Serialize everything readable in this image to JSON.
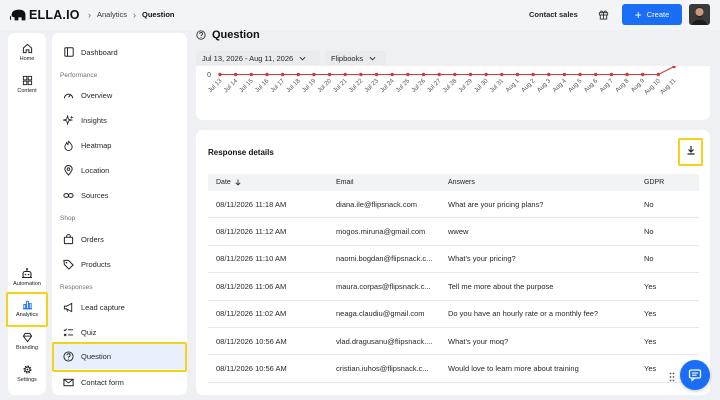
{
  "brand": {
    "name": "ELLA.IO",
    "accent": "#1a6ef5",
    "highlight": "#f5d21a"
  },
  "breadcrumb": {
    "items": [
      "Analytics",
      "Question"
    ]
  },
  "header": {
    "contact_sales": "Contact sales",
    "create_label": "Create"
  },
  "rail": {
    "items": [
      {
        "label": "Home",
        "icon": "home-icon"
      },
      {
        "label": "Content",
        "icon": "grid-icon"
      },
      {
        "label": "Automation",
        "icon": "robot-icon"
      },
      {
        "label": "Analytics",
        "icon": "bar-chart-icon",
        "active": true
      },
      {
        "label": "Branding",
        "icon": "diamond-icon"
      },
      {
        "label": "Settings",
        "icon": "gear-icon"
      }
    ]
  },
  "subnav": {
    "dashboard": "Dashboard",
    "section_performance": "Performance",
    "overview": "Overview",
    "insights": "Insights",
    "heatmap": "Heatmap",
    "location": "Location",
    "sources": "Sources",
    "section_shop": "Shop",
    "orders": "Orders",
    "products": "Products",
    "section_responses": "Responses",
    "lead_capture": "Lead capture",
    "quiz": "Quiz",
    "question": "Question",
    "contact_form": "Contact form"
  },
  "page": {
    "title": "Question",
    "date_range": "Jul 13, 2026 - Aug 11, 2026",
    "content_filter": "Flipbooks"
  },
  "chart_data": {
    "type": "line",
    "x": [
      "Jul 13",
      "Jul 14",
      "Jul 15",
      "Jul 16",
      "Jul 17",
      "Jul 18",
      "Jul 19",
      "Jul 20",
      "Jul 21",
      "Jul 22",
      "Jul 23",
      "Jul 24",
      "Jul 25",
      "Jul 26",
      "Jul 27",
      "Jul 28",
      "Jul 29",
      "Jul 30",
      "Jul 31",
      "Aug 1",
      "Aug 2",
      "Aug 3",
      "Aug 4",
      "Aug 5",
      "Aug 6",
      "Aug 7",
      "Aug 8",
      "Aug 9",
      "Aug 10",
      "Aug 11"
    ],
    "values": [
      0,
      0,
      0,
      0,
      0,
      0,
      0,
      0,
      0,
      0,
      0,
      0,
      0,
      0,
      0,
      0,
      0,
      0,
      0,
      0,
      0,
      0,
      0,
      0,
      0,
      0,
      0,
      0,
      0,
      7
    ],
    "visible_y_ticks": [
      "0"
    ],
    "line_color": "#d0383e",
    "grid": false
  },
  "responses": {
    "title": "Response details",
    "columns": [
      "Date",
      "Email",
      "Answers",
      "GDPR"
    ],
    "rows": [
      {
        "date": "08/11/2026 11:18 AM",
        "email": "diana.ile@flipsnack.com",
        "answer": "What are your pricing plans?",
        "gdpr": "No"
      },
      {
        "date": "08/11/2026 11:12 AM",
        "email": "mogos.miruna@gmail.com",
        "answer": "wwew",
        "gdpr": "No"
      },
      {
        "date": "08/11/2026 11:10 AM",
        "email": "naomi.bogdan@flipsnack.c...",
        "answer": "What's your pricing?",
        "gdpr": "No"
      },
      {
        "date": "08/11/2026 11:06 AM",
        "email": "maura.corpas@flipsnack.c...",
        "answer": "Tell me more about the purpose",
        "gdpr": "Yes"
      },
      {
        "date": "08/11/2026 11:02 AM",
        "email": "neaga.claudiu@gmail.com",
        "answer": "Do you have an hourly rate or a monthly fee?",
        "gdpr": "Yes"
      },
      {
        "date": "08/11/2026 10:56 AM",
        "email": "vlad.dragusanu@flipsnack....",
        "answer": "What's your moq?",
        "gdpr": "Yes"
      },
      {
        "date": "08/11/2026 10:56 AM",
        "email": "cristian.iuhos@flipsnack.c...",
        "answer": "Would love to learn more about training",
        "gdpr": "Yes"
      }
    ]
  }
}
